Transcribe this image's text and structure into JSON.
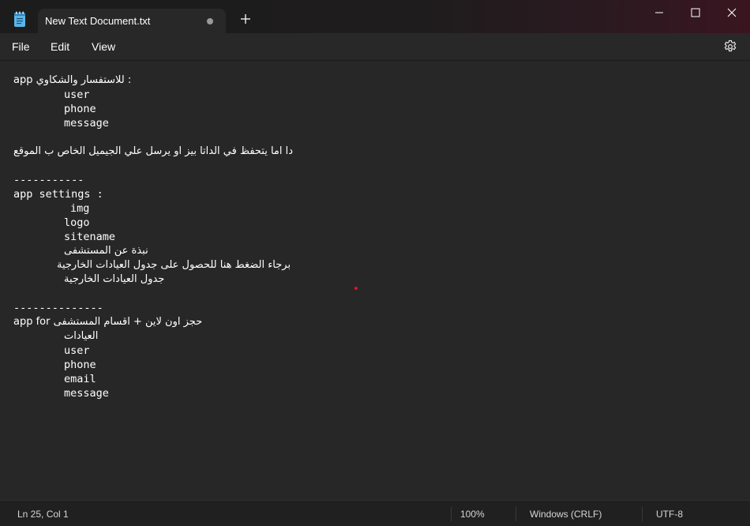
{
  "window": {
    "tab_title": "New Text Document.txt",
    "app_icon": "notepad-icon",
    "new_tab_icon": "plus-icon",
    "controls": [
      "minimize-icon",
      "maximize-icon",
      "close-icon"
    ]
  },
  "menu": {
    "file": "File",
    "edit": "Edit",
    "view": "View",
    "settings_icon": "gear-icon"
  },
  "editor": {
    "lines": [
      "app للاستفسار والشكاوي :",
      "user",
      "phone",
      "message",
      "دا اما يتحفظ في الداتا بيز او يرسل علي الجيميل الخاص ب الموقع",
      "-----------",
      "app settings :",
      "img",
      "logo",
      "sitename",
      "نبذة عن المستشفى",
      "برجاء الضغط هنا للحصول على جدول العيادات الخارجية",
      "جدول العيادات الخارجية",
      "--------------",
      "app for حجز اون لاين + اقسام المستشفى",
      "العيادات",
      "user",
      "phone",
      "email",
      "message"
    ]
  },
  "status": {
    "position": "Ln 25, Col 1",
    "zoom": "100%",
    "line_ending": "Windows (CRLF)",
    "encoding": "UTF-8"
  },
  "colors": {
    "background": "#272727",
    "text": "#ffffff",
    "statusbar": "#202020"
  }
}
